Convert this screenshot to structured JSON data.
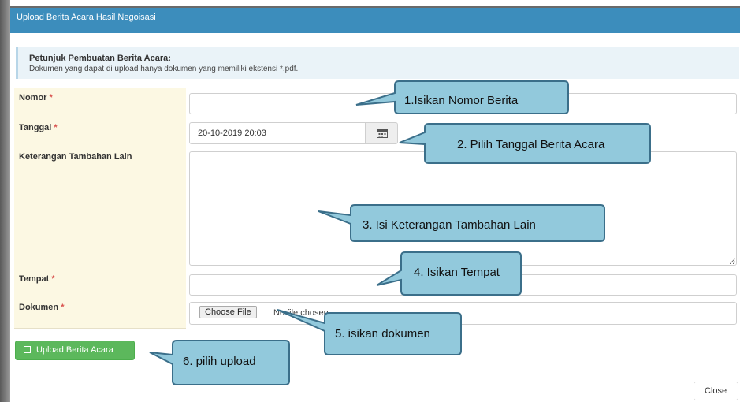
{
  "modal": {
    "title": "Upload Berita Acara Hasil Negoisasi"
  },
  "info": {
    "title": "Petunjuk Pembuatan Berita Acara:",
    "text": "Dokumen yang dapat di upload hanya dokumen yang memiliki ekstensi *.pdf."
  },
  "form": {
    "nomor_label": "Nomor",
    "tanggal_label": "Tanggal",
    "tanggal_value": "20-10-2019 20:03",
    "keterangan_label": "Keterangan Tambahan Lain",
    "tempat_label": "Tempat",
    "dokumen_label": "Dokumen",
    "required_mark": "*",
    "choose_file_label": "Choose File",
    "no_file_text": "No file chosen"
  },
  "buttons": {
    "upload_label": "Upload Berita Acara",
    "close_label": "Close"
  },
  "callouts": {
    "c1": "1.Isikan Nomor Berita",
    "c2": "2. Pilih Tanggal Berita Acara",
    "c3": "3. Isi Keterangan Tambahan Lain",
    "c4": "4. Isikan Tempat",
    "c5": "5. isikan dokumen",
    "c6": "6. pilih upload"
  },
  "colors": {
    "header": "#3c8dbc",
    "label_bg": "#fcf8e3",
    "upload_btn": "#5cb85c",
    "callout_fill": "#92c9dc",
    "callout_border": "#3b6f8a"
  },
  "icons": {
    "calendar": "calendar-icon",
    "upload": "save-icon"
  }
}
